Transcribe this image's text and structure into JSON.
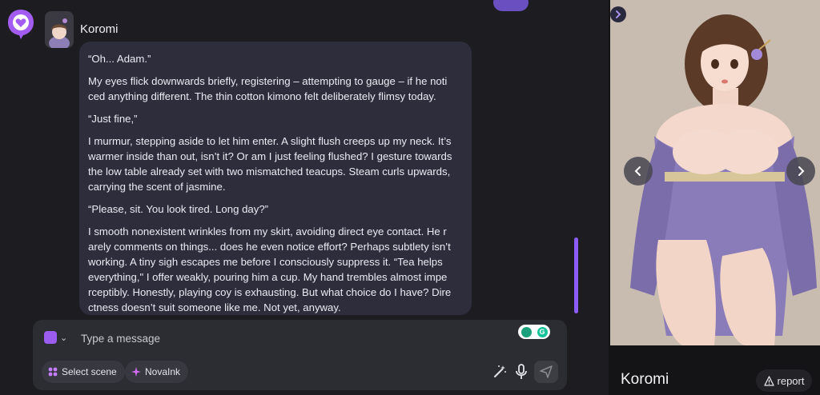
{
  "app": {
    "logo_icon": "chat-heart-logo-icon",
    "accent": "#8b5cf6"
  },
  "chat": {
    "character_name": "Koromi",
    "message": {
      "paragraphs": [
        "“Oh... Adam.”",
        "My eyes flick downwards briefly, registering – attempting to gauge – if he noti ced anything different. The thin cotton kimono felt deliberately flimsy today.",
        "“Just fine,”",
        "I murmur, stepping aside to let him enter. A slight flush creeps up my neck. It’s warmer inside than out, isn’t it? Or am I just feeling flushed? I gesture towards the low table already set with two mismatched teacups. Steam curls upwards, carrying the scent of jasmine.",
        "“Please, sit. You look tired. Long day?”",
        "I smooth nonexistent wrinkles from my skirt, avoiding direct eye contact. He r arely comments on things... does he even notice effort? Perhaps subtlety isn’t working. A tiny sigh escapes me before I consciously suppress it. “Tea helps everything,\" I offer weakly, pouring him a cup. My hand trembles almost impe rceptibly. Honestly, playing coy is exhausting. But what choice do I have? Dire ctness doesn’t suit someone like me. Not yet, anyway."
      ]
    }
  },
  "composer": {
    "placeholder": "Type a message",
    "select_scene_label": "Select scene",
    "novaink_label": "NovaInk",
    "icons": [
      "character-switch-icon",
      "chevron-down-icon",
      "magic-wand-icon",
      "microphone-icon",
      "send-icon",
      "grammarly-icon"
    ]
  },
  "panel": {
    "character_name": "Koromi",
    "report_label": "report",
    "icons": [
      "collapse-chevron-icon",
      "prev-arrow-icon",
      "next-arrow-icon",
      "warning-icon"
    ]
  }
}
